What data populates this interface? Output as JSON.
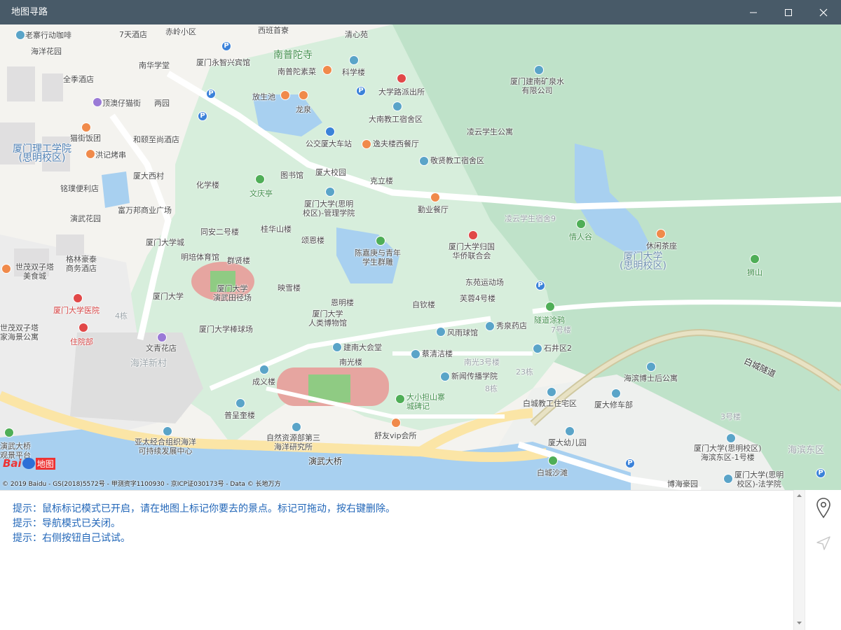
{
  "window": {
    "title": "地图寻路",
    "controls": {
      "minimize": "minimize-icon",
      "maximize": "maximize-icon",
      "close": "close-icon"
    }
  },
  "map": {
    "areas": {
      "xmut": "厦门理工学院\n(思明校区)",
      "xmu": "厦门大学\n(思明校区)",
      "haiyang": "海洋新村",
      "haibin": "海滨东区"
    },
    "roads": {
      "yanwu": "演武大桥",
      "baicheng": "白城隧道"
    },
    "pois": [
      "老寨行动咖啡",
      "7天酒店",
      "赤岭小区",
      "西班首寮",
      "清心苑",
      "海洋花园",
      "南华学堂",
      "厦门永智兴宾馆",
      "南普陀寺",
      "南普陀素菜",
      "科学楼",
      "全季酒店",
      "大学路派出所",
      "厦门建南矿泉水\n有限公司",
      "顶澳仔猫街",
      "两园",
      "放生池",
      "龙泉",
      "大南教工宿舍区",
      "凌云学生公寓",
      "猫街饭团",
      "和颐至尚酒店",
      "公交厦大车站",
      "逸夫楼西餐厅",
      "洪记烤串",
      "敬贤教工宿舍区",
      "图书馆",
      "厦大校园",
      "厦大西村",
      "克立楼",
      "铭璞便利店",
      "化学楼",
      "文庆亭",
      "富万邦商业广场",
      "厦门大学(思明\n校区)-管理学院",
      "勤业餐厅",
      "演武花园",
      "同安二号楼",
      "桂华山楼",
      "凌云学生宿舍9",
      "情人谷",
      "厦门大学城",
      "颂恩楼",
      "陈嘉庚与青年\n学生群雕",
      "厦门大学归国\n华侨联合会",
      "休闲茶座",
      "格林豪泰\n商务酒店",
      "明培体育馆",
      "群贤楼",
      "世茂双子塔\n美食城",
      "映雪楼",
      "厦门大学\n演武田径场",
      "东苑运动场",
      "厦门大学",
      "恩明楼",
      "芙蓉4号楼",
      "自钦楼",
      "狮山",
      "厦门大学医院",
      "厦门大学\n人类博物馆",
      "隧道涂鸦",
      "世茂双子塔\n家海景公寓",
      "厦门大学棒球场",
      "风雨球馆",
      "秀泉药店",
      "住院部",
      "文青花店",
      "建南大会堂",
      "石井区2",
      "蔡清洁楼",
      "南光楼",
      "海滨博士后公寓",
      "成义楼",
      "新闻传播学院",
      "大小担山寨\n城碑记",
      "白城教工住宅区",
      "厦大修车部",
      "普呈奎楼",
      "亚太经合组织海洋\n可持续发展中心",
      "自然资源部第三\n海洋研究所",
      "舒友vip会所",
      "厦大幼儿园",
      "厦门大学(思明校区)\n海滨东区-1号楼",
      "演武大桥\n观景平台",
      "白城沙滩",
      "博海豪园",
      "厦门大学(思明\n校区)-法学院",
      "南光3号楼",
      "23栋",
      "8栋",
      "7号楼",
      "3号楼",
      "4栋"
    ],
    "copyright": "© 2019 Baidu - GS(2018)5572号 - 甲测资字1100930 - 京ICP证030173号 - Data © 长地万方",
    "logo_text": "Bai",
    "logo_text2": "地图"
  },
  "log": {
    "lines": [
      "提示：鼠标标记模式已开启，请在地图上标记你要去的景点。标记可拖动，按右键删除。",
      "提示：导航模式已关闭。",
      "提示：右侧按钮自己试试。"
    ]
  },
  "sidebar": {
    "buttons": [
      "location-pin-icon",
      "navigation-arrow-icon"
    ]
  },
  "colors": {
    "titlebar": "#485a68",
    "campus_green": "#d7eedc",
    "forest": "#bfe2c9",
    "water": "#a8d0f0",
    "road_yellow": "#fbe5a6",
    "log_text": "#2166b8"
  }
}
